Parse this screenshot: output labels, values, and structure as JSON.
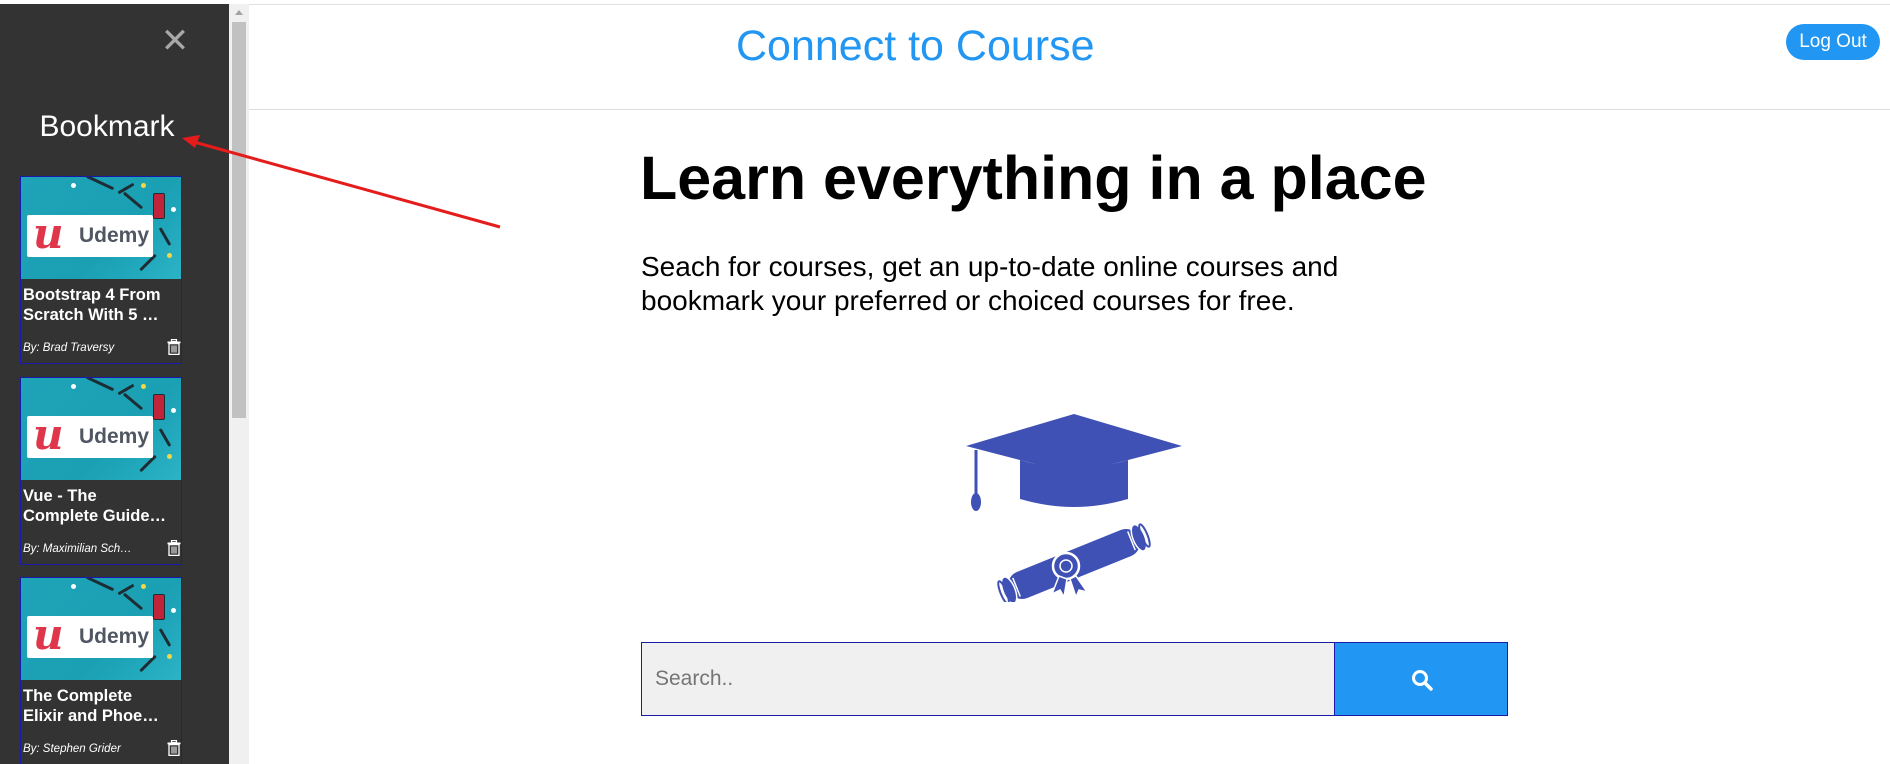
{
  "sidebar": {
    "title": "Bookmark",
    "close_icon": "close-icon",
    "cards": [
      {
        "logo_word": "Udemy",
        "title_line1": "Bootstrap 4 From",
        "title_line2": "Scratch With 5 …",
        "author": "By: Brad Traversy"
      },
      {
        "logo_word": "Udemy",
        "title_line1": "Vue - The",
        "title_line2": "Complete Guide…",
        "author": "By: Maximilian Sch…"
      },
      {
        "logo_word": "Udemy",
        "title_line1": "The Complete",
        "title_line2": "Elixir and Phoe…",
        "author": "By: Stephen Grider"
      }
    ]
  },
  "header": {
    "title": "Connect to Course",
    "logout_label": "Log Out"
  },
  "main": {
    "hero_title": "Learn everything in a place",
    "hero_text": "Seach for courses, get an up-to-date online courses and bookmark your preferred or choiced courses for free.",
    "search": {
      "placeholder": "Search..",
      "value": ""
    }
  },
  "colors": {
    "brand_blue": "#2196f3",
    "sidebar_bg": "#333333",
    "icon_indigo": "#3f51b5",
    "annotation_red": "#e51c1c",
    "udemy_red": "#e0364c"
  },
  "icons": {
    "logo_mark": "udemy-u-logo",
    "trash": "trash-icon",
    "search": "search-icon",
    "hero": "graduation-cap-diploma-icon",
    "annotation": "red-arrow-annotation"
  }
}
